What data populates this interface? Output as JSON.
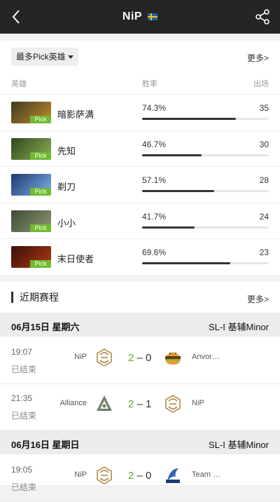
{
  "topbar": {
    "title": "NiP"
  },
  "heroes": {
    "filter_label": "最多Pick英雄",
    "more_label": "更多>",
    "col_hero": "英雄",
    "col_winrate": "胜率",
    "col_games": "出场",
    "rows": [
      {
        "name": "暗影萨满",
        "badge": "Pick",
        "winrate_text": "74.3%",
        "winrate": 74.3,
        "games": "35",
        "colors": [
          "#3d3a22",
          "#c48c2a"
        ]
      },
      {
        "name": "先知",
        "badge": "Pick",
        "winrate_text": "46.7%",
        "winrate": 46.7,
        "games": "30",
        "colors": [
          "#2c4a1c",
          "#8fae54"
        ]
      },
      {
        "name": "剃刀",
        "badge": "Pick",
        "winrate_text": "57.1%",
        "winrate": 57.1,
        "games": "28",
        "colors": [
          "#1d3870",
          "#7cb2e8"
        ]
      },
      {
        "name": "小小",
        "badge": "Pick",
        "winrate_text": "41.7%",
        "winrate": 41.7,
        "games": "24",
        "colors": [
          "#3f4a36",
          "#8d9a72"
        ]
      },
      {
        "name": "末日使者",
        "badge": "Pick",
        "winrate_text": "69.6%",
        "winrate": 69.6,
        "games": "23",
        "colors": [
          "#3a1008",
          "#b03a14"
        ]
      }
    ]
  },
  "matches": {
    "title": "近期赛程",
    "more_label": "更多>",
    "days": [
      {
        "date": "06月15日  星期六",
        "league": "SL-I 基辅Minor"
      },
      {
        "date": "06月16日  星期日",
        "league": "SL-I 基辅Minor"
      }
    ],
    "items": [
      {
        "time": "19:07",
        "status": "已结束",
        "team_left": "NiP",
        "logo_left": "nip-logo",
        "score_left": "2",
        "sep": "–",
        "score_right": "0",
        "team_right": "Anvor…",
        "logo_right": "burger-logo"
      },
      {
        "time": "21:35",
        "status": "已结束",
        "team_left": "Alliance",
        "logo_left": "alliance-logo",
        "score_left": "2",
        "sep": "–",
        "score_right": "1",
        "team_right": "NiP",
        "logo_right": "nip-logo"
      },
      {
        "time": "19:05",
        "status": "已结束",
        "team_left": "NiP",
        "logo_left": "nip-logo",
        "score_left": "2",
        "sep": "–",
        "score_right": "0",
        "team_right": "Team …",
        "logo_right": "team-logo"
      }
    ]
  }
}
